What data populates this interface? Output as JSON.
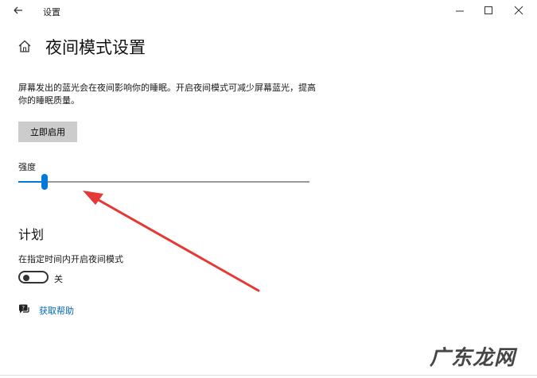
{
  "window": {
    "title": "设置",
    "back_icon": "back-arrow-icon",
    "minimize_icon": "minimize-icon",
    "maximize_icon": "maximize-icon",
    "close_icon": "close-icon"
  },
  "page": {
    "home_icon": "home-icon",
    "title": "夜间模式设置",
    "description": "屏幕发出的蓝光会在夜间影响你的睡眠。开启夜间模式可减少屏幕蓝光，提高你的睡眠质量。",
    "apply_button_label": "立即启用",
    "strength_label": "强度",
    "strength_value_fraction": 0.09
  },
  "schedule": {
    "heading": "计划",
    "label": "在指定时间内开启夜间模式",
    "toggle_state": "关",
    "toggle_on": false
  },
  "help": {
    "icon": "help-chat-icon",
    "link_label": "获取帮助"
  },
  "watermark": {
    "text": "广东龙网"
  },
  "colors": {
    "accent": "#0078d7",
    "link": "#0067b8",
    "annotation_arrow": "#e53935",
    "button_bg": "#cccccc"
  }
}
